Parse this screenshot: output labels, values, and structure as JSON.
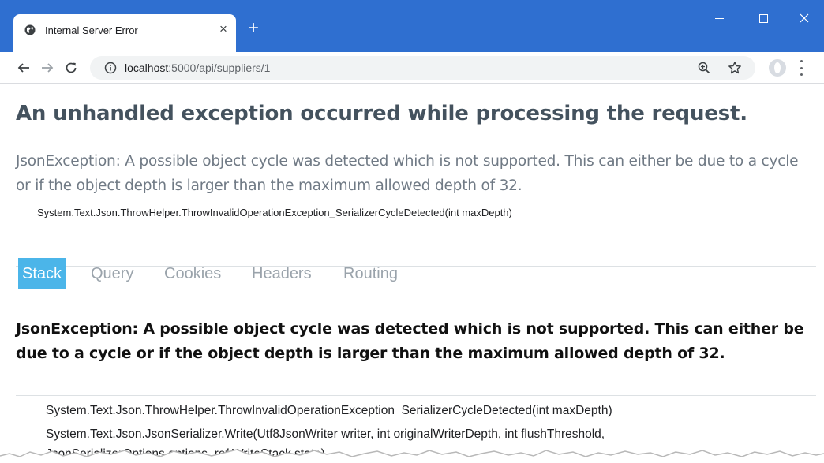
{
  "browser": {
    "tab_title": "Internal Server Error",
    "url_host": "localhost",
    "url_path": ":5000/api/suppliers/1",
    "accent_color": "#2f6fd0",
    "icons": [
      "globe-icon",
      "close-icon",
      "plus-icon",
      "minimize-icon",
      "maximize-icon",
      "close-window-icon",
      "back-icon",
      "forward-icon",
      "reload-icon",
      "info-icon",
      "zoom-icon",
      "star-icon",
      "profile-icon",
      "menu-icon"
    ]
  },
  "page": {
    "title": "An unhandled exception occurred while processing the request.",
    "message": "JsonException: A possible object cycle was detected which is not supported. This can either be due to a cycle or if the object depth is larger than the maximum allowed depth of 32.",
    "location": "System.Text.Json.ThrowHelper.ThrowInvalidOperationException_SerializerCycleDetected(int maxDepth)",
    "tabs": [
      {
        "label": "Stack",
        "active": true
      },
      {
        "label": "Query",
        "active": false
      },
      {
        "label": "Cookies",
        "active": false
      },
      {
        "label": "Headers",
        "active": false
      },
      {
        "label": "Routing",
        "active": false
      }
    ],
    "active_tab_color": "#4bb5e9",
    "stack_heading": "JsonException: A possible object cycle was detected which is not supported. This can either be due to a cycle or if the object depth is larger than the maximum allowed depth of 32.",
    "frames": [
      "System.Text.Json.ThrowHelper.ThrowInvalidOperationException_SerializerCycleDetected(int maxDepth)",
      "System.Text.Json.JsonSerializer.Write(Utf8JsonWriter writer, int originalWriterDepth, int flushThreshold,",
      "JsonSerializerOptions options, ref WriteStack state)"
    ]
  }
}
